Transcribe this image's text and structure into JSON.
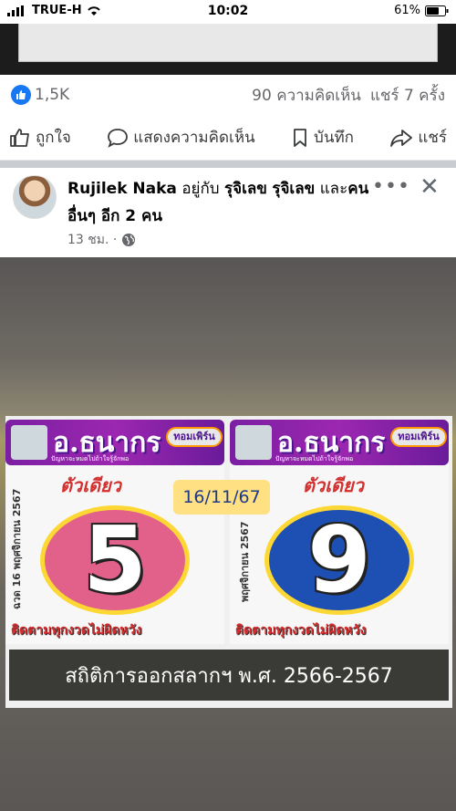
{
  "status_bar": {
    "carrier": "TRUE-H",
    "time": "10:02",
    "battery": "61%"
  },
  "reactions": {
    "like_count": "1,5K",
    "comments": "90 ความคิดเห็น",
    "shares": "แชร์ 7 ครั้ง"
  },
  "actions": {
    "like": "ถูกใจ",
    "comment": "แสดงความคิดเห็น",
    "save": "บันทึก",
    "share": "แชร์"
  },
  "post": {
    "author": "Rujilek Naka",
    "with_text": "อยู่กับ",
    "tagged1": "รุจิเลข",
    "tagged2": "รุจิเลข",
    "and_text": "และ",
    "others": "คนอื่นๆ อีก 2 คน",
    "time": "13 ชม. ·"
  },
  "image": {
    "brand": "อ.ธนากร",
    "tag_pill": "ทอมเพิร์น",
    "tagline": "ปัญหาจะหมดไปถ้าใจรู้จักพอ",
    "sub_left": "ตัวเดียว",
    "sub_right": "ตัวเดียว",
    "date_left": "ฉวด 16 พฤศจิกายน 2567",
    "date_right": "พฤศจิกายน 2567",
    "number_left": "5",
    "number_right": "9",
    "follow_left": "ติดตามทุกงวดไม่ผิดหวัง",
    "follow_right": "ติดตามทุกงวดไม่ผิดหวัง",
    "date_badge": "16/11/67",
    "stats": "สถิติการออกสลากฯ พ.ศ. 2566-2567"
  },
  "colors": {
    "facebook_blue": "#1877f2",
    "ball_left": "#e2618a",
    "ball_right": "#1e50b4"
  }
}
